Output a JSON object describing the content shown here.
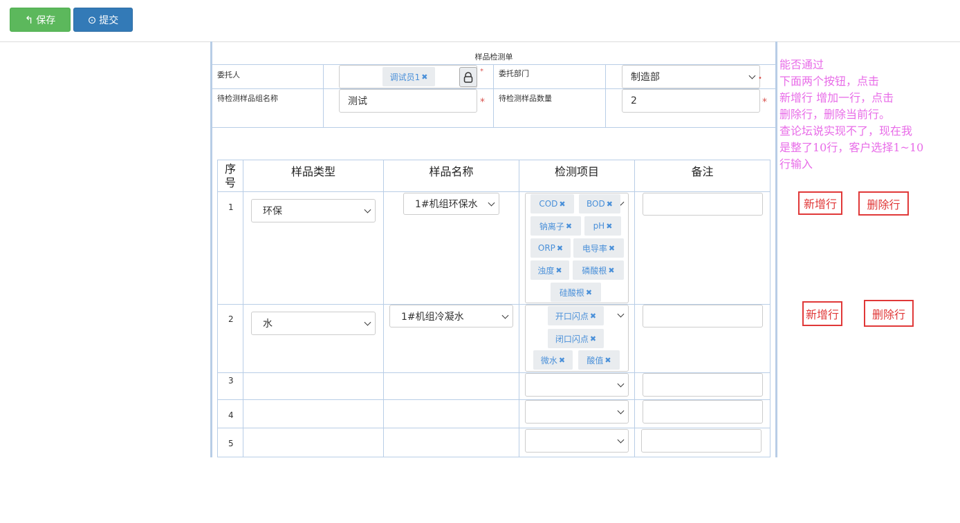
{
  "toolbar": {
    "save_label": "保存",
    "submit_label": "提交"
  },
  "form": {
    "title": "样品检测单",
    "client_label": "委托人",
    "client_tag": "调试员1",
    "dept_label": "委托部门",
    "dept_value": "制造部",
    "group_name_label": "待检测样品组名称",
    "group_name_value": "测试",
    "count_label": "待检测样品数量",
    "count_value": "2"
  },
  "table": {
    "headers": {
      "seq": "序号",
      "type": "样品类型",
      "name": "样品名称",
      "items": "检测项目",
      "remark": "备注"
    },
    "rows": [
      {
        "seq": "1",
        "type": "环保",
        "name": "1#机组环保水",
        "items": [
          "COD",
          "BOD",
          "钠离子",
          "pH",
          "ORP",
          "电导率",
          "浊度",
          "磷酸根",
          "硅酸根"
        ]
      },
      {
        "seq": "2",
        "type": "水",
        "name": "1#机组冷凝水",
        "items": [
          "开口闪点",
          "闭口闪点",
          "微水",
          "酸值"
        ]
      },
      {
        "seq": "3"
      },
      {
        "seq": "4"
      },
      {
        "seq": "5"
      }
    ]
  },
  "note": {
    "lines": [
      "能否通过",
      "下面两个按钮，点击",
      "新增行 增加一行，点击",
      "删除行，删除当前行。",
      "查论坛说实现不了，现在我",
      "是整了10行，客户选择1~10",
      "行输入"
    ]
  },
  "actions": {
    "add_row": "新增行",
    "delete_row": "删除行"
  },
  "colors": {
    "note": "#e86ce8",
    "red_button": "#e03838",
    "tag_text": "#4a90d9"
  }
}
